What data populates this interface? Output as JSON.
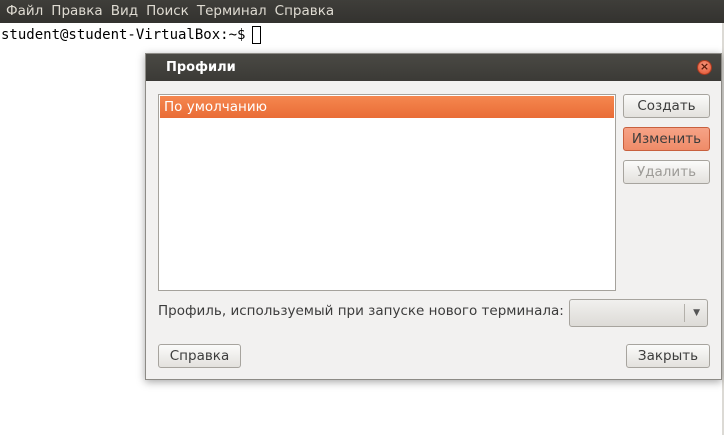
{
  "menubar": {
    "items": [
      "Файл",
      "Правка",
      "Вид",
      "Поиск",
      "Терминал",
      "Справка"
    ]
  },
  "terminal": {
    "prompt": "student@student-VirtualBox:~$"
  },
  "dialog": {
    "title": "Профили",
    "profiles": [
      "По умолчанию"
    ],
    "selected_profile": "По умолчанию",
    "buttons": {
      "create": "Создать",
      "edit": "Изменить",
      "delete": "Удалить",
      "help": "Справка",
      "close": "Закрыть"
    },
    "default_profile_label": "Профиль, используемый при запуске нового терминала:",
    "default_profile_value": ""
  },
  "colors": {
    "accent": "#e96c36",
    "titlebar": "#3b3a36",
    "dialog_bg": "#f2f1f0"
  }
}
